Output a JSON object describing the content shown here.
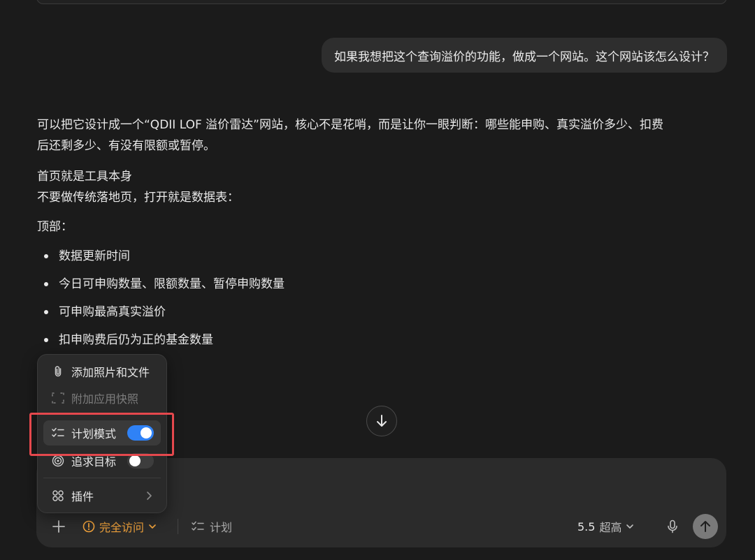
{
  "conversation": {
    "user_message": "如果我想把这个查询溢价的功能，做成一个网站。这个网站该怎么设计？",
    "answer": {
      "paragraph1_line1": "可以把它设计成一个“QDII LOF 溢价雷达”网站，核心不是花哨，而是让你一眼判断：哪些能申购、真实溢价多少、扣费",
      "paragraph1_line2": "后还剩多少、有没有限额或暂停。",
      "heading": "首页就是工具本身",
      "paragraph2": "不要做传统落地页，打开就是数据表：",
      "section_label": "顶部：",
      "bullets": [
        "数据更新时间",
        "今日可申购数量、限额数量、暂停申购数量",
        "可申购最高真实溢价",
        "扣申购费后仍为正的基金数量"
      ]
    }
  },
  "menu": {
    "add_files": "添加照片和文件",
    "attach_snapshot": "附加应用快照",
    "plan_mode": "计划模式",
    "plan_mode_on": true,
    "pursue_goal": "追求目标",
    "pursue_goal_on": false,
    "plugins": "插件"
  },
  "composer": {
    "access_label": "完全访问",
    "plan_label": "计划",
    "model_version": "5.5",
    "model_level": "超高"
  },
  "colors": {
    "background": "#1b1b1b",
    "accent_orange": "#f0a23b",
    "toggle_blue": "#2f82f6",
    "highlight_red": "#e5484d"
  },
  "icons": [
    "paperclip-icon",
    "snapshot-icon",
    "checklist-icon",
    "target-icon",
    "plugins-icon",
    "chevron-right-icon",
    "plus-icon",
    "warning-icon",
    "chevron-down-icon",
    "mic-icon",
    "arrow-up-icon",
    "arrow-down-icon"
  ]
}
